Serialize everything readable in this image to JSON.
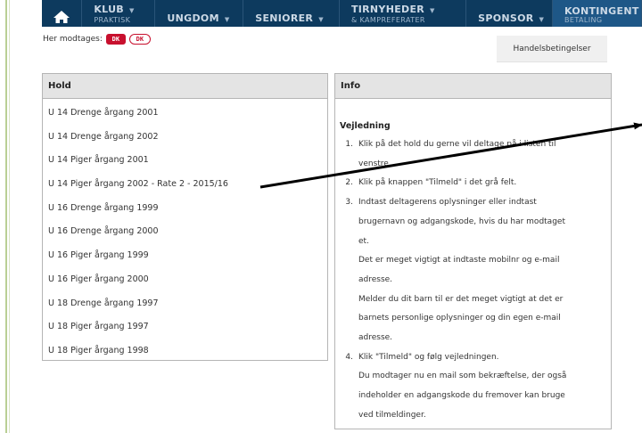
{
  "nav": {
    "items": [
      {
        "label": "KLUB",
        "sub": "PRAKTISK",
        "caret": "▼"
      },
      {
        "label": "UNGDOM",
        "sub": "",
        "caret": "▼"
      },
      {
        "label": "SENIORER",
        "sub": "",
        "caret": "▼"
      },
      {
        "label": "TIRNYHEDER",
        "sub": "& KAMPREFERATER",
        "caret": "▼"
      },
      {
        "label": "SPONSOR",
        "sub": "",
        "caret": "▼"
      },
      {
        "label": "KONTINGENT",
        "sub": "BETALING",
        "caret": ""
      }
    ]
  },
  "payment": {
    "label": "Her modtages:",
    "logos": [
      "DK",
      "DK"
    ]
  },
  "handelsbetingelser": "Handelsbetingelser",
  "hold": {
    "title": "Hold",
    "items": [
      "U 14 Drenge årgang 2001",
      "U 14 Drenge årgang 2002",
      "U 14 Piger årgang 2001",
      "U 14 Piger årgang 2002 - Rate 2 - 2015/16",
      "U 16 Drenge årgang 1999",
      "U 16 Drenge årgang 2000",
      "U 16 Piger årgang 1999",
      "U 16 Piger årgang 2000",
      "U 18 Drenge årgang 1997",
      "U 18 Piger årgang 1997",
      "U 18 Piger årgang 1998"
    ]
  },
  "info": {
    "title": "Info",
    "heading": "Vejledning",
    "steps": [
      {
        "num": "1.",
        "text": "Klik på det hold du gerne vil deltage på i listen til\nvenstre."
      },
      {
        "num": "2.",
        "text": "Klik på knappen \"Tilmeld\" i det grå felt."
      },
      {
        "num": "3.",
        "text": "Indtast deltagerens oplysninger eller indtast\nbrugernavn og adgangskode, hvis du har modtaget\net.\nDet er meget vigtigt at indtaste mobilnr og e-mail\nadresse.\nMelder du dit barn til er det meget vigtigt at det er\nbarnets personlige oplysninger og din egen e-mail\nadresse."
      },
      {
        "num": "4.",
        "text": "Klik \"Tilmeld\" og følg vejledningen.\nDu modtager nu en mail som bekræftelse, der også\nindeholder en adgangskode du fremover kan bruge\nved tilmeldinger."
      }
    ]
  }
}
